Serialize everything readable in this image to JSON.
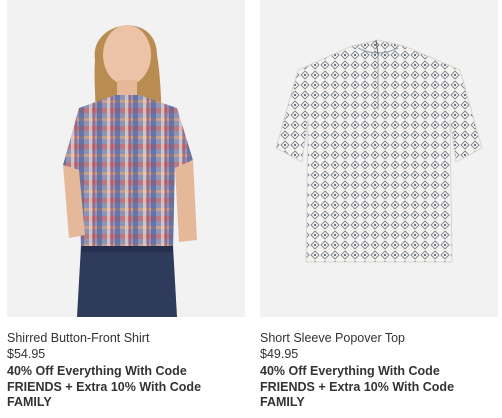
{
  "products": [
    {
      "name": "Shirred Button-Front Shirt",
      "price": "$54.95",
      "promo": "40% Off Everything With Code\nFRIENDS + Extra 10% With Code\nFAMILY",
      "image_icon": "model-wearing-plaid-shirt"
    },
    {
      "name": "Short Sleeve Popover Top",
      "price": "$49.95",
      "promo": "40% Off Everything With Code\nFRIENDS + Extra 10% With Code\nFAMILY",
      "image_icon": "white-print-top-flat"
    }
  ],
  "colors": {
    "text": "#333333",
    "image_bg": "#f2f2f2"
  }
}
